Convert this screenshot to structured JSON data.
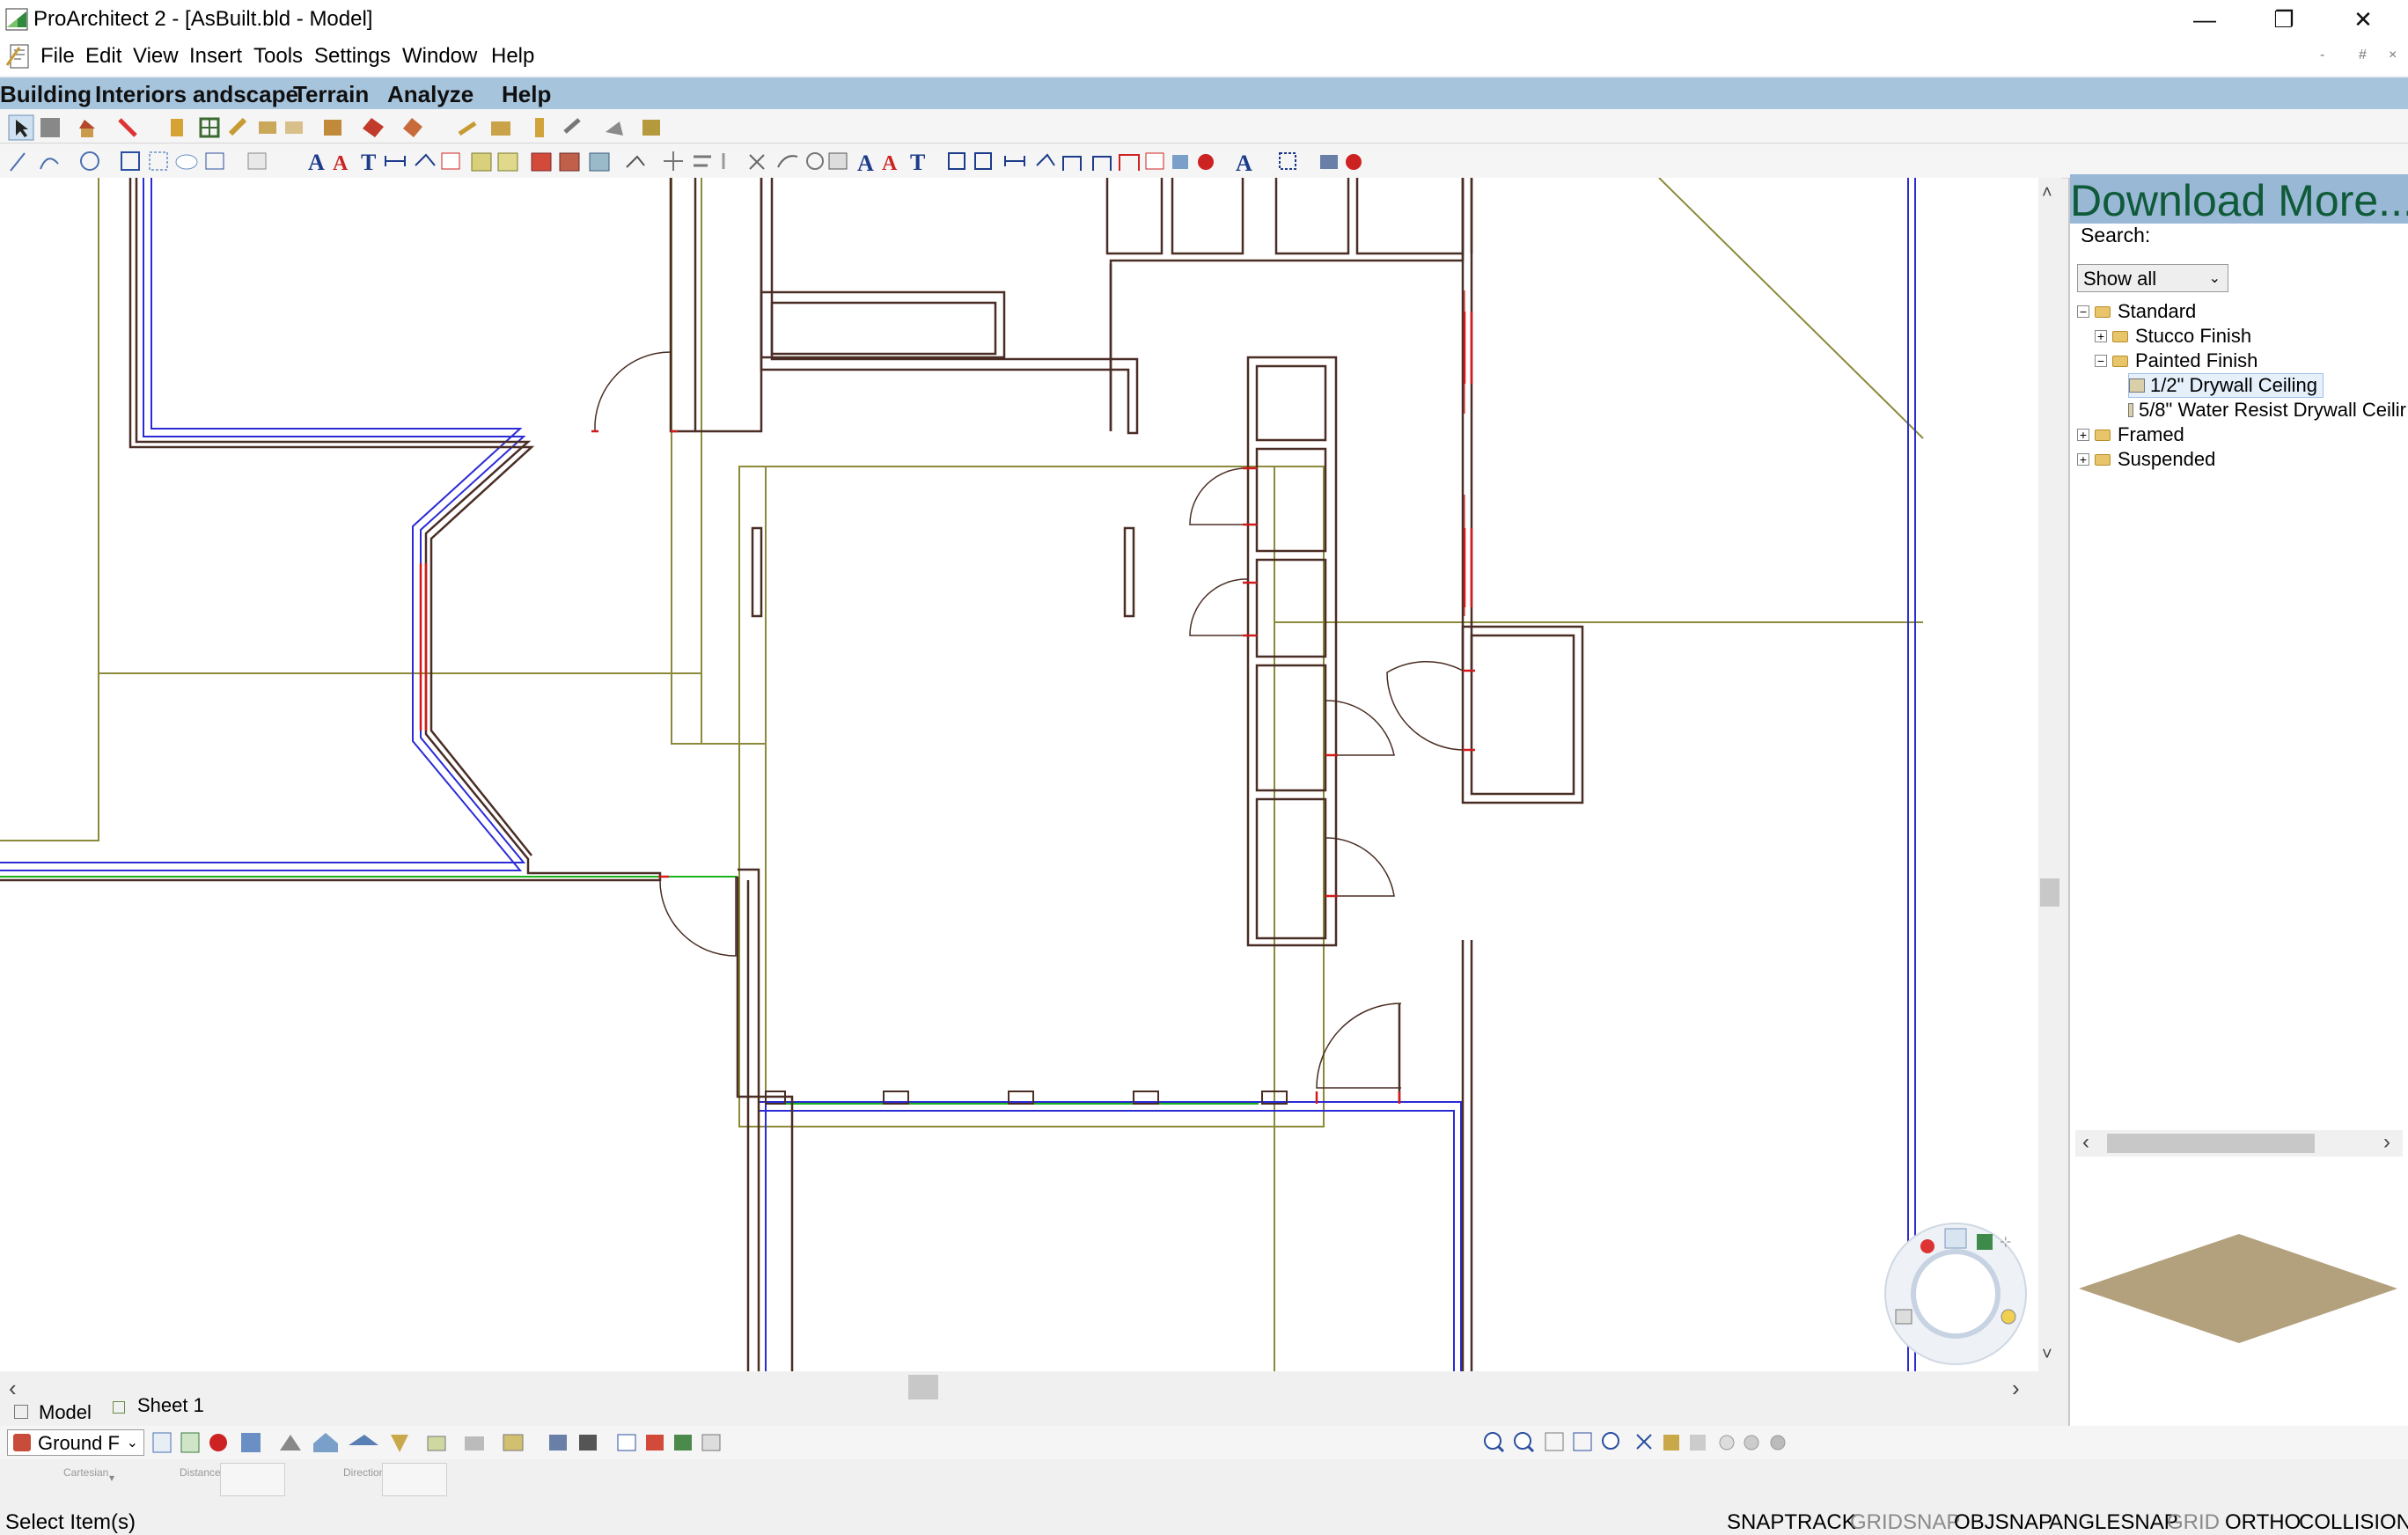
{
  "window": {
    "title": "ProArchitect 2 - [AsBuilt.bld - Model]",
    "minimize_glyph": "—",
    "restore_glyph": "❐",
    "close_glyph": "✕"
  },
  "menu": {
    "items": [
      "File",
      "Edit",
      "View",
      "Insert",
      "Tools",
      "Settings",
      "Window",
      "Help"
    ],
    "mdi_minimize": "-",
    "mdi_restore": "#",
    "mdi_close": "×"
  },
  "ribbon": {
    "tabs": [
      "Building",
      "Interiors",
      "andscape",
      "Terrain",
      "Analyze",
      "Help"
    ]
  },
  "panel": {
    "download_text": "Download More...",
    "search_label": "Search:",
    "filter_value": "Show all",
    "tree": [
      {
        "label": "Standard",
        "expander": "−",
        "kind": "folder",
        "level": 0
      },
      {
        "label": "Stucco Finish",
        "expander": "+",
        "kind": "folder",
        "level": 1
      },
      {
        "label": "Painted Finish",
        "expander": "−",
        "kind": "folder",
        "level": 1
      },
      {
        "label": "1/2\" Drywall Ceiling",
        "kind": "material",
        "level": 2,
        "selected": true
      },
      {
        "label": "5/8\" Water Resist Drywall Ceilir",
        "kind": "material",
        "level": 2
      },
      {
        "label": "Framed",
        "expander": "+",
        "kind": "folder",
        "level": 0
      },
      {
        "label": "Suspended",
        "expander": "+",
        "kind": "folder",
        "level": 0
      }
    ],
    "scroll_left": "‹",
    "scroll_right": "›"
  },
  "sheets": {
    "model_tab": "Model",
    "sheet_tab": "Sheet 1"
  },
  "level": {
    "current": "Ground F"
  },
  "coords": {
    "system_label": "Cartesian",
    "distance_label": "Distance",
    "direction_label": "Direction"
  },
  "status": {
    "prompt": "Select Item(s)",
    "toggles": [
      {
        "label": "SNAPTRACK",
        "active": true
      },
      {
        "label": "GRIDSNAP",
        "active": false
      },
      {
        "label": "OBJSNAP",
        "active": true
      },
      {
        "label": "ANGLESNAP",
        "active": true
      },
      {
        "label": "GRID",
        "active": false
      },
      {
        "label": "ORTHO",
        "active": true
      },
      {
        "label": "COLLISION",
        "active": true
      }
    ]
  },
  "colors": {
    "ribbon": "#a7c4dd",
    "wall": "#4a2d24",
    "door_red": "#d21a1a",
    "outline_blue": "#2b2bd6",
    "room_olive": "#8b8a3a",
    "window_green": "#19b319",
    "preview_tan": "#b3a07d",
    "download_green": "#0f5a38"
  },
  "scrollbars": {
    "up": "˄",
    "down": "˅",
    "left": "‹",
    "right": "›"
  }
}
